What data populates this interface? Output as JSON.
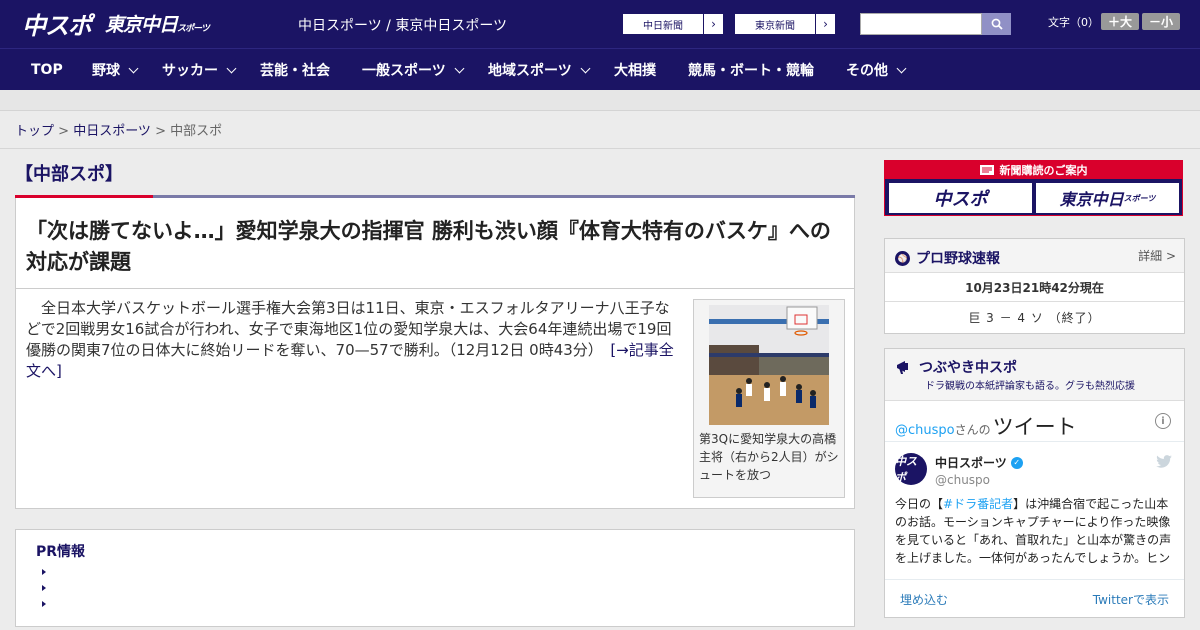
{
  "header": {
    "logo_primary": "中スポ",
    "logo_secondary": "東京中日",
    "logo_secondary_small": "スポーツ",
    "site_name": "中日スポーツ / 東京中日スポーツ",
    "ext_links": [
      {
        "label": "中日新聞",
        "arrow": "›"
      },
      {
        "label": "東京新聞",
        "arrow": "›"
      }
    ],
    "search_placeholder": "",
    "font_size_label": "文字（0）",
    "font_bigger": "＋大",
    "font_smaller": "－小"
  },
  "nav": [
    {
      "label": "TOP",
      "dropdown": false
    },
    {
      "label": "野球",
      "dropdown": true
    },
    {
      "label": "サッカー",
      "dropdown": true
    },
    {
      "label": "芸能・社会",
      "dropdown": false
    },
    {
      "label": "一般スポーツ",
      "dropdown": true
    },
    {
      "label": "地域スポーツ",
      "dropdown": true
    },
    {
      "label": "大相撲",
      "dropdown": false
    },
    {
      "label": "競馬・ボート・競輪",
      "dropdown": false
    },
    {
      "label": "その他",
      "dropdown": true
    }
  ],
  "breadcrumb": {
    "home": "トップ",
    "sep1": " > ",
    "parent": "中日スポーツ",
    "sep2": " > ",
    "current": "中部スポ"
  },
  "section": {
    "title": "【中部スポ】"
  },
  "article": {
    "headline": "「次は勝てないよ…」愛知学泉大の指揮官 勝利も渋い顔『体育大特有のバスケ』への対応が課題",
    "lead": "全日本大学バスケットボール選手権大会第3日は11日、東京・エスフォルタアリーナ八王子などで2回戦男女16試合が行われ、女子で東海地区1位の愛知学泉大は、大会64年連続出場で19回優勝の関東7位の日体大に終始リードを奪い、70—57で勝利。（12月12日 0時43分）",
    "more_link": "[→記事全文へ]",
    "photo_caption": "第3Qに愛知学泉大の高橋主将（右から2人目）がシュートを放つ"
  },
  "pr": {
    "title": "PR情報",
    "items": [
      "",
      "",
      ""
    ]
  },
  "sidebar": {
    "subscribe": {
      "title": "新聞購読のご案内",
      "paper1": "中スポ",
      "paper2": "東京中日",
      "paper2_small": "スポーツ"
    },
    "baseball": {
      "title": "プロ野球速報",
      "detail": "詳細 >",
      "updated": "10月23日21時42分現在",
      "score": "巨 3 － 4 ソ （終了）"
    },
    "twitter": {
      "widget_title": "つぶやき中スポ",
      "widget_subtitle": "ドラ観戦の本紙評論家も語る。グラも熱烈応援",
      "handle": "@chuspo",
      "san": "さんの",
      "tweet_word": "ツイート",
      "info": "i",
      "account_name": "中日スポーツ",
      "account_user": "@chuspo",
      "avatar_text": "中スポ",
      "text_before": "今日の【",
      "hashtag": "#ドラ番記者",
      "text_after": "】は沖縄合宿で起こった山本のお話。モーションキャプチャーにより作った映像を見ていると「あれ、首取れた」と山本が驚きの声を上げました。一体何があったんでしょうか。ヒン",
      "embed": "埋め込む",
      "view_on": "Twitterで表示"
    }
  },
  "colors": {
    "brand": "#1b1464",
    "accent_red": "#d9002c",
    "twitter_blue": "#1da1f2"
  }
}
